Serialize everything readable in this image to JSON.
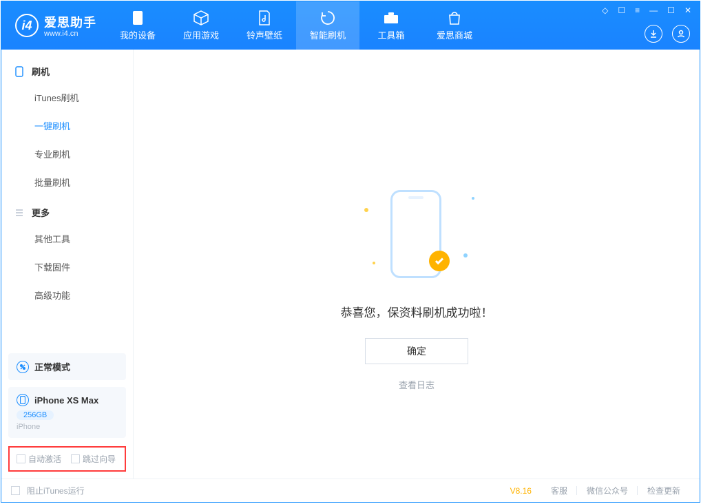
{
  "app": {
    "title_cn": "爱思助手",
    "title_en": "www.i4.cn"
  },
  "header": {
    "tabs": [
      {
        "label": "我的设备"
      },
      {
        "label": "应用游戏"
      },
      {
        "label": "铃声壁纸"
      },
      {
        "label": "智能刷机"
      },
      {
        "label": "工具箱"
      },
      {
        "label": "爱思商城"
      }
    ]
  },
  "sidebar": {
    "group1": {
      "title": "刷机",
      "items": [
        "iTunes刷机",
        "一键刷机",
        "专业刷机",
        "批量刷机"
      ]
    },
    "group2": {
      "title": "更多",
      "items": [
        "其他工具",
        "下载固件",
        "高级功能"
      ]
    },
    "mode_label": "正常模式",
    "device": {
      "name": "iPhone XS Max",
      "storage": "256GB",
      "model": "iPhone"
    },
    "opts": {
      "auto_activate": "自动激活",
      "skip_wizard": "跳过向导"
    }
  },
  "main": {
    "success_msg": "恭喜您，保资料刷机成功啦！",
    "ok_btn": "确定",
    "view_log": "查看日志"
  },
  "footer": {
    "block_itunes": "阻止iTunes运行",
    "version": "V8.16",
    "links": [
      "客服",
      "微信公众号",
      "检查更新"
    ]
  }
}
